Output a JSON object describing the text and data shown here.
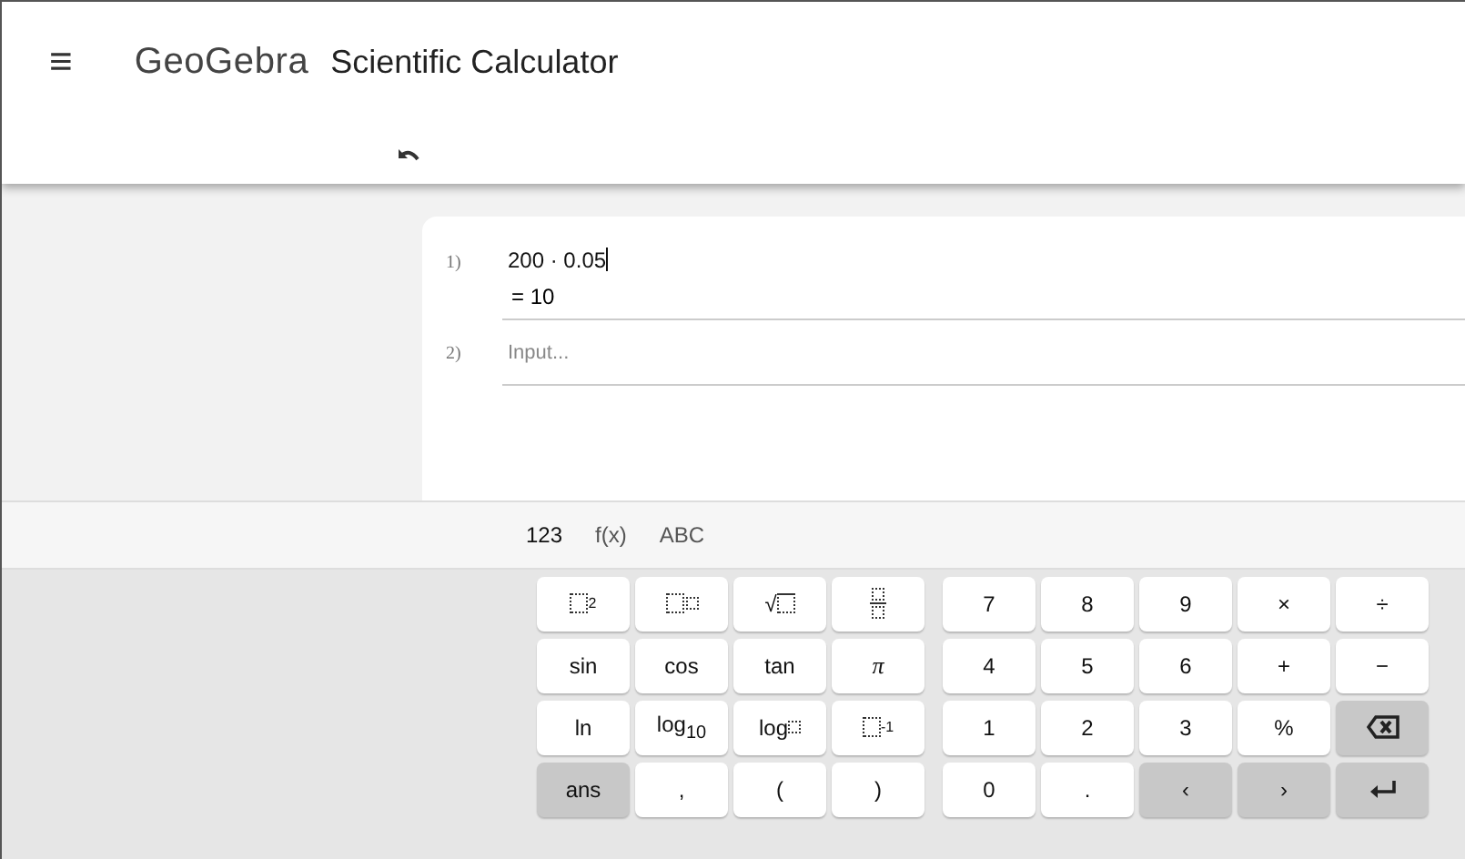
{
  "header": {
    "menu": "≡",
    "logo": "GeoGebra",
    "title": "Scientific Calculator"
  },
  "algebra": {
    "rows": [
      {
        "number": "1)",
        "value": "200 · 0.05",
        "result": "= 10"
      },
      {
        "number": "2)",
        "placeholder": "Input..."
      }
    ]
  },
  "keyboard": {
    "tabs": [
      {
        "label": "123",
        "selected": true
      },
      {
        "label": "f(x)",
        "selected": false
      },
      {
        "label": "ABC",
        "selected": false
      }
    ],
    "left": [
      {
        "kind": "power",
        "label": "2",
        "dark": false
      },
      {
        "kind": "power-box",
        "dark": false
      },
      {
        "kind": "sqrt",
        "label": "√",
        "dark": false
      },
      {
        "kind": "fraction",
        "dark": false
      },
      {
        "kind": "text",
        "label": "sin",
        "dark": false
      },
      {
        "kind": "text",
        "label": "cos",
        "dark": false
      },
      {
        "kind": "text",
        "label": "tan",
        "dark": false
      },
      {
        "kind": "italic",
        "label": "π",
        "dark": false
      },
      {
        "kind": "text",
        "label": "ln",
        "dark": false
      },
      {
        "kind": "text",
        "label": "log$_{10}$",
        "dark": false
      },
      {
        "kind": "log-base",
        "label": "log",
        "dark": false
      },
      {
        "kind": "power",
        "label": "-1",
        "dark": false
      },
      {
        "kind": "text",
        "label": "ans",
        "dark": true
      },
      {
        "kind": "text",
        "label": ",",
        "dark": false
      },
      {
        "kind": "text",
        "label": "(",
        "dark": false
      },
      {
        "kind": "text",
        "label": ")",
        "dark": false
      }
    ],
    "right": [
      {
        "kind": "text",
        "label": "7",
        "dark": false
      },
      {
        "kind": "text",
        "label": "8",
        "dark": false
      },
      {
        "kind": "text",
        "label": "9",
        "dark": false
      },
      {
        "kind": "text",
        "label": "×",
        "dark": false
      },
      {
        "kind": "text",
        "label": "÷",
        "dark": false
      },
      {
        "kind": "text",
        "label": "4",
        "dark": false
      },
      {
        "kind": "text",
        "label": "5",
        "dark": false
      },
      {
        "kind": "text",
        "label": "6",
        "dark": false
      },
      {
        "kind": "text",
        "label": "+",
        "dark": false
      },
      {
        "kind": "text",
        "label": "−",
        "dark": false
      },
      {
        "kind": "text",
        "label": "1",
        "dark": false
      },
      {
        "kind": "text",
        "label": "2",
        "dark": false
      },
      {
        "kind": "text",
        "label": "3",
        "dark": false
      },
      {
        "kind": "text",
        "label": "%",
        "dark": false
      },
      {
        "kind": "backspace",
        "dark": true
      },
      {
        "kind": "text",
        "label": "0",
        "dark": false
      },
      {
        "kind": "text",
        "label": ".",
        "dark": false
      },
      {
        "kind": "text",
        "label": "‹",
        "dark": true
      },
      {
        "kind": "text",
        "label": "›",
        "dark": true
      },
      {
        "kind": "enter",
        "dark": true
      }
    ]
  }
}
